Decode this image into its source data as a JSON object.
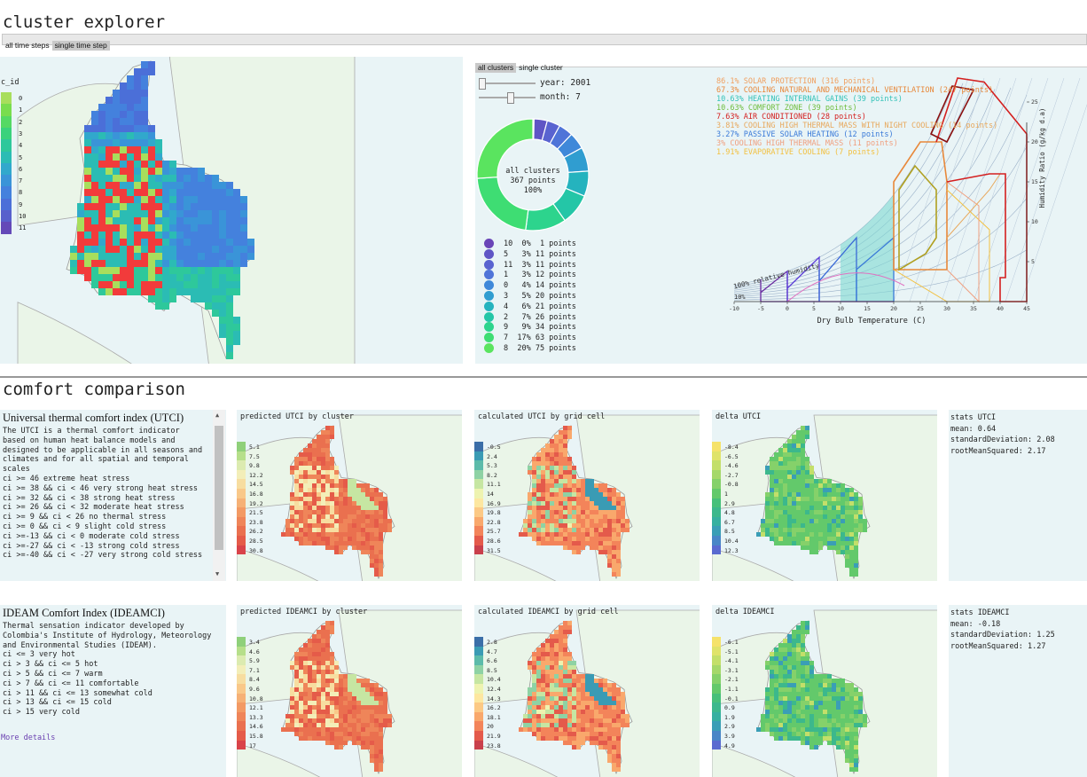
{
  "app": {
    "title": "cluster explorer",
    "tabs": [
      "all time steps",
      "single time step"
    ]
  },
  "map_legend": {
    "title": "c_id",
    "items": [
      {
        "label": "0",
        "color": "#a8de5c"
      },
      {
        "label": "1",
        "color": "#79dd4e"
      },
      {
        "label": "2",
        "color": "#55d964"
      },
      {
        "label": "3",
        "color": "#3ad27c"
      },
      {
        "label": "4",
        "color": "#2ec89b"
      },
      {
        "label": "5",
        "color": "#2bbcb4"
      },
      {
        "label": "6",
        "color": "#31a8cc"
      },
      {
        "label": "7",
        "color": "#3a94d8"
      },
      {
        "label": "8",
        "color": "#4481dd"
      },
      {
        "label": "9",
        "color": "#4b6fd8"
      },
      {
        "label": "10",
        "color": "#5860cc"
      },
      {
        "label": "11",
        "color": "#6449b8"
      }
    ]
  },
  "cluster_panel": {
    "tabs": [
      "all clusters",
      "single cluster"
    ],
    "year_label": "year:",
    "year_value": "2001",
    "month_label": "month:",
    "month_value": "7",
    "donut_center": {
      "line1": "all clusters",
      "line2": "367 points",
      "line3": "100%"
    },
    "legend": [
      {
        "text": "10  0%  1 points",
        "color": "#6a45b7"
      },
      {
        "text": "5   3% 11 points",
        "color": "#5f55c5"
      },
      {
        "text": "11  3% 11 points",
        "color": "#5963d0"
      },
      {
        "text": "1   3% 12 points",
        "color": "#4f74d8"
      },
      {
        "text": "0   4% 14 points",
        "color": "#3f88d9"
      },
      {
        "text": "3   5% 20 points",
        "color": "#309dd0"
      },
      {
        "text": "4   6% 21 points",
        "color": "#25b3be"
      },
      {
        "text": "2   7% 26 points",
        "color": "#24c6a7"
      },
      {
        "text": "9   9% 34 points",
        "color": "#2dd48d"
      },
      {
        "text": "7  17% 63 points",
        "color": "#3edd73"
      },
      {
        "text": "8  20% 75 points",
        "color": "#5ae45f"
      }
    ],
    "donut_values": [
      1,
      11,
      11,
      12,
      14,
      20,
      21,
      26,
      34,
      63,
      75
    ]
  },
  "psychro": {
    "annotations": [
      {
        "text": "86.1% SOLAR PROTECTION (316 points)",
        "color": "#f0a060"
      },
      {
        "text": "67.3% COOLING NATURAL AND MECHANICAL VENTILATION (247 points)",
        "color": "#e8883a"
      },
      {
        "text": "10.63% HEATING INTERNAL GAINS (39 points)",
        "color": "#33c2b8"
      },
      {
        "text": "10.63% COMFORT ZONE (39 points)",
        "color": "#6ebd3c"
      },
      {
        "text": "7.63% AIR CONDITIONED (28 points)",
        "color": "#d42020"
      },
      {
        "text": "3.81% COOLING HIGH THERMAL MASS WITH NIGHT COOLING (14 points)",
        "color": "#e8a85c"
      },
      {
        "text": "3.27% PASSIVE SOLAR HEATING (12 points)",
        "color": "#3a7ad8"
      },
      {
        "text": "3% COOLING HIGH THERMAL MASS (11 points)",
        "color": "#f0a080"
      },
      {
        "text": "1.91% EVAPORATIVE COOLING (7 points)",
        "color": "#f2c040"
      }
    ],
    "rh_label": "100% relative humidity",
    "rh10_label": "10%",
    "x_label": "Dry Bulb Temperature (C)",
    "y_label": "Humidity Ratio (g/kg d.a)",
    "x_ticks": [
      "-10",
      "-5",
      "0",
      "5",
      "10",
      "15",
      "20",
      "25",
      "30",
      "35",
      "40",
      "45"
    ],
    "y_ticks": [
      "5",
      "10",
      "15",
      "20",
      "25"
    ]
  },
  "comfort": {
    "title": "comfort comparison",
    "utci": {
      "heading": "Universal thermal comfort index (UTCI)",
      "lines": [
        "The UTCI is a thermal comfort indicator",
        "based on human heat balance models and",
        "designed to be applicable in all seasons and",
        "climates and for all spatial and temporal",
        "scales",
        "ci >= 46 extreme heat stress",
        "ci >= 38 && ci < 46 very strong heat stress",
        "ci >= 32 && ci < 38 strong heat stress",
        "ci >= 26 && ci < 32 moderate heat stress",
        "ci >= 9 && ci < 26 no thermal stress",
        "ci >= 0 && ci < 9 slight cold stress",
        "ci >=-13 && ci < 0 moderate cold stress",
        "ci >=-27 && ci < -13 strong cold stress",
        "ci >=-40 && ci < -27 very strong cold stress"
      ],
      "pred_title": "predicted UTCI by cluster",
      "calc_title": "calculated UTCI by grid cell",
      "delta_title": "delta UTCI",
      "pred_scale": [
        "5.1",
        "7.5",
        "9.8",
        "12.2",
        "14.5",
        "16.8",
        "19.2",
        "21.5",
        "23.8",
        "26.2",
        "28.5",
        "30.8"
      ],
      "calc_scale": [
        "-0.5",
        "2.4",
        "5.3",
        "8.2",
        "11.1",
        "14",
        "16.9",
        "19.8",
        "22.8",
        "25.7",
        "28.6",
        "31.5"
      ],
      "delta_scale": [
        "-8.4",
        "-6.5",
        "-4.6",
        "-2.7",
        "-0.8",
        "1",
        "2.9",
        "4.8",
        "6.7",
        "8.5",
        "10.4",
        "12.3"
      ],
      "stats_title": "stats UTCI",
      "stats": [
        "mean: 0.64",
        "standardDeviation: 2.08",
        "rootMeanSquared: 2.17"
      ]
    },
    "ideam": {
      "heading": "IDEAM Comfort Index (IDEAMCI)",
      "lines": [
        "Thermal sensation indicator developed by",
        "Colombia's Institute of Hydrology, Meteorology",
        "and Environmental Studies (IDEAM).",
        "ci <= 3 very hot",
        "ci > 3 && ci <= 5 hot",
        "ci > 5 && ci <= 7 warm",
        "ci > 7 && ci <= 11 comfortable",
        "ci > 11 && ci <= 13 somewhat cold",
        "ci > 13 && ci <= 15 cold",
        "ci > 15 very cold"
      ],
      "more": "More details",
      "pred_title": "predicted IDEAMCI by cluster",
      "calc_title": "calculated IDEAMCI by grid cell",
      "delta_title": "delta IDEAMCI",
      "pred_scale": [
        "3.4",
        "4.6",
        "5.9",
        "7.1",
        "8.4",
        "9.6",
        "10.8",
        "12.1",
        "13.3",
        "14.6",
        "15.8",
        "17"
      ],
      "calc_scale": [
        "2.8",
        "4.7",
        "6.6",
        "8.5",
        "10.4",
        "12.4",
        "14.3",
        "16.2",
        "18.1",
        "20",
        "21.9",
        "23.8"
      ],
      "delta_scale": [
        "-6.1",
        "-5.1",
        "-4.1",
        "-3.1",
        "-2.1",
        "-1.1",
        "-0.1",
        "0.9",
        "1.9",
        "2.9",
        "3.9",
        "4.9"
      ],
      "stats_title": "stats IDEAMCI",
      "stats": [
        "mean: -0.18",
        "standardDeviation: 1.25",
        "rootMeanSquared: 1.27"
      ]
    }
  }
}
